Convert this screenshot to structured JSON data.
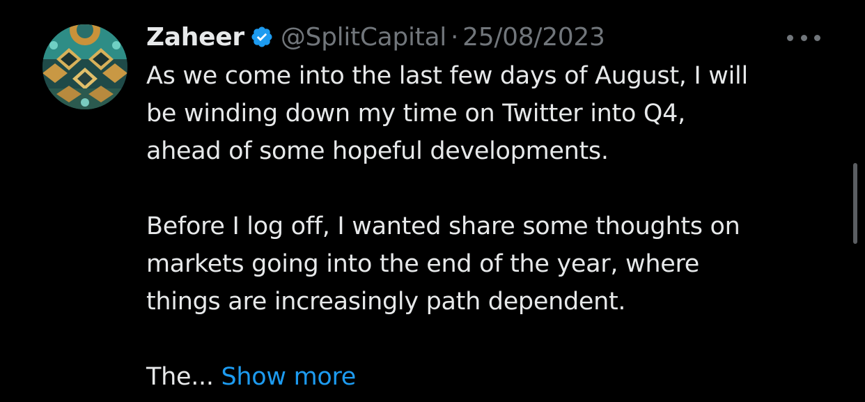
{
  "tweet": {
    "display_name": "Zaheer",
    "handle": "@SplitCapital",
    "separator": "·",
    "date": "25/08/2023",
    "verified": true,
    "paragraphs": [
      [
        "As we come into the last few days of August, I will",
        "be winding down my time on Twitter into Q4,",
        "ahead of some hopeful developments."
      ],
      [
        "Before I log off, I wanted share some thoughts on",
        "markets going into the end of the year, where",
        "things are increasingly path dependent."
      ]
    ],
    "truncated_text": "The...",
    "show_more_label": "Show more"
  },
  "icons": {
    "verified": "verified-badge-icon",
    "more": "more-options-icon"
  },
  "colors": {
    "background": "#000000",
    "text": "#e7e9ea",
    "secondary_text": "#71767b",
    "link": "#1d9bf0",
    "verified": "#1d9bf0"
  }
}
